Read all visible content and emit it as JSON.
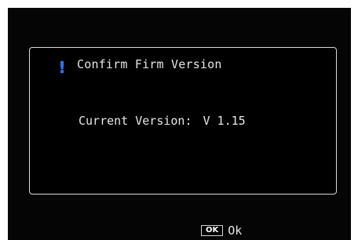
{
  "dialog": {
    "title": "Confirm Firm Version",
    "version_label": "Current Version:",
    "version_value": "V 1.15",
    "icon": "exclamation-icon"
  },
  "footer": {
    "key_label": "OK",
    "action_label": "Ok"
  },
  "colors": {
    "background": "#050505",
    "text": "#e6e6e6",
    "accent": "#2f74ff",
    "border": "#d8d8d8"
  }
}
